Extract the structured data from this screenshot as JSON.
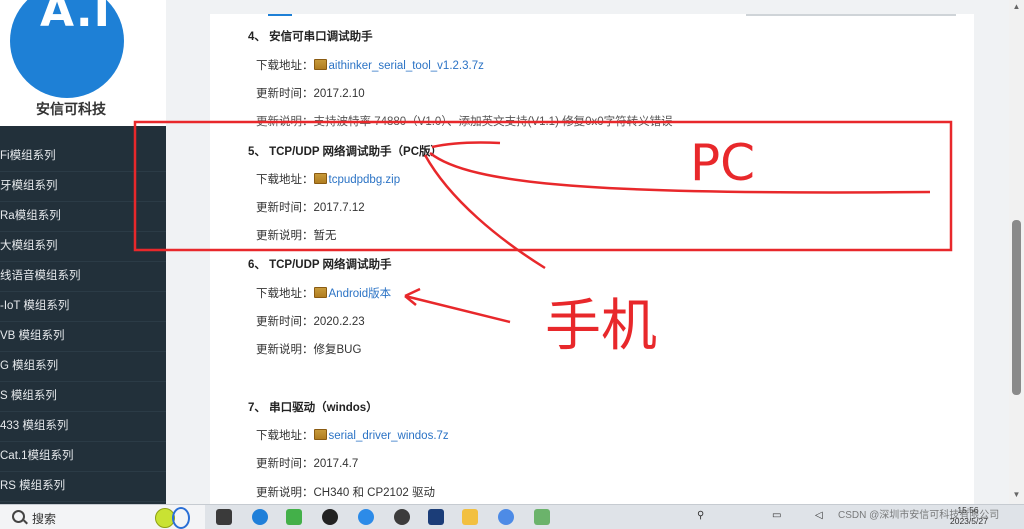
{
  "brand": {
    "logo_text": "A.I",
    "name": "安信可科技",
    "color": "#1e80d6"
  },
  "nav": {
    "items": [
      "Fi模组系列",
      "牙模组系列",
      "Ra模组系列",
      "大模组系列",
      "线语音模组系列",
      "-IoT 模组系列",
      "VB 模组系列",
      "G 模组系列",
      "S 模组系列",
      "433 模组系列",
      "Cat.1模组系列",
      "RS 模组系列"
    ]
  },
  "sections": [
    {
      "title": "4、 安信可串口调试助手",
      "download_label": "下载地址：",
      "download_link": "aithinker_serial_tool_v1.2.3.7z",
      "time_label": "更新时间：",
      "time": "2017.2.10",
      "desc_label": "更新说明：",
      "desc": "支持波特率 74880（V1.0）、添加英文支持(V1.1) 修复0x0字符转义错误"
    },
    {
      "title": "5、 TCP/UDP 网络调试助手（PC版）",
      "download_label": "下载地址：",
      "download_link": "tcpudpdbg.zip",
      "time_label": "更新时间：",
      "time": "2017.7.12",
      "desc_label": "更新说明：",
      "desc": "暂无"
    },
    {
      "title": "6、 TCP/UDP 网络调试助手",
      "download_label": "下载地址：",
      "download_link": "Android版本",
      "time_label": "更新时间：",
      "time": "2020.2.23",
      "desc_label": "更新说明：",
      "desc": "修复BUG"
    },
    {
      "title": "7、 串口驱动（windos）",
      "download_label": "下载地址：",
      "download_link": "serial_driver_windos.7z",
      "time_label": "更新时间：",
      "time": "2017.4.7",
      "desc_label": "更新说明：",
      "desc": "CH340 和 CP2102 驱动"
    }
  ],
  "annotations": {
    "pc_text": "PC",
    "phone_text": "手机",
    "color": "#e8282b"
  },
  "taskbar": {
    "search_label": "搜索",
    "clock_time": "15:56",
    "clock_date": "2023/5/27",
    "watermark": "CSDN @深圳市安信可科技有限公司"
  },
  "link_color": "#2b73c5"
}
